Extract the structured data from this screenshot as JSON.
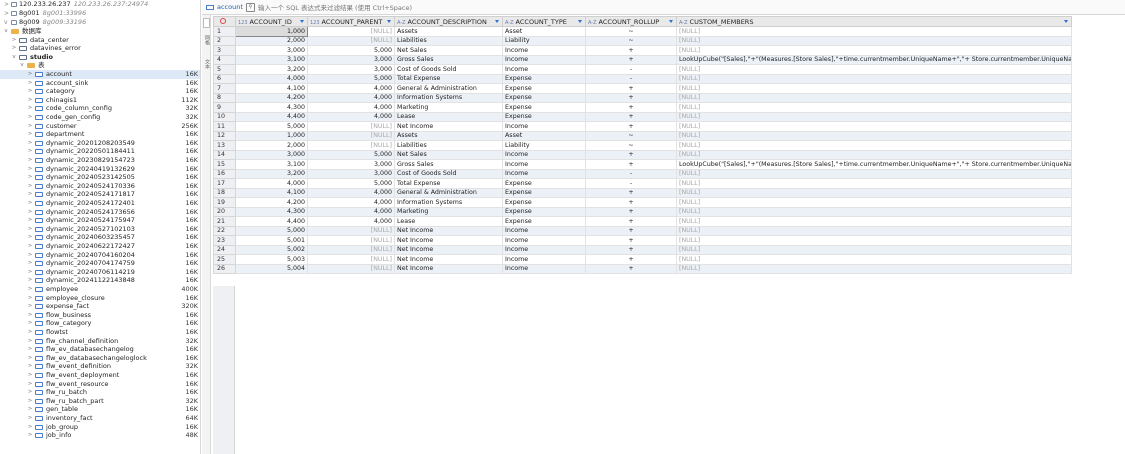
{
  "connections": [
    {
      "name": "120.233.26.237",
      "address": "120.233.26.237:24974",
      "toggle": ">"
    },
    {
      "name": "8g001",
      "address": "8g001:33996",
      "toggle": ">"
    },
    {
      "name": "8g009",
      "address": "8g009:33196",
      "toggle": "v"
    }
  ],
  "tree": [
    {
      "label": "数据库",
      "level": 1,
      "toggle": "v",
      "kind": "db",
      "size": ""
    },
    {
      "label": "data_center",
      "level": 2,
      "toggle": ">",
      "kind": "dt",
      "size": ""
    },
    {
      "label": "datavines_error",
      "level": 2,
      "toggle": ">",
      "kind": "dt",
      "size": ""
    },
    {
      "label": "studio",
      "level": 2,
      "toggle": "v",
      "kind": "dt",
      "size": "",
      "bold": true
    },
    {
      "label": "表",
      "level": 3,
      "toggle": "v",
      "kind": "db",
      "size": ""
    },
    {
      "label": "account",
      "level": 4,
      "toggle": ">",
      "kind": "tb",
      "size": "16K",
      "selected": true
    },
    {
      "label": "account_sink",
      "level": 4,
      "toggle": ">",
      "kind": "tb",
      "size": "16K"
    },
    {
      "label": "category",
      "level": 4,
      "toggle": ">",
      "kind": "tb",
      "size": "16K"
    },
    {
      "label": "chinagis1",
      "level": 4,
      "toggle": ">",
      "kind": "tb",
      "size": "112K"
    },
    {
      "label": "code_column_config",
      "level": 4,
      "toggle": ">",
      "kind": "tb",
      "size": "32K"
    },
    {
      "label": "code_gen_config",
      "level": 4,
      "toggle": ">",
      "kind": "tb",
      "size": "32K"
    },
    {
      "label": "customer",
      "level": 4,
      "toggle": ">",
      "kind": "tb",
      "size": "256K"
    },
    {
      "label": "department",
      "level": 4,
      "toggle": ">",
      "kind": "tb",
      "size": "16K"
    },
    {
      "label": "dynamic_20201208203549",
      "level": 4,
      "toggle": ">",
      "kind": "tb",
      "size": "16K"
    },
    {
      "label": "dynamic_20220501184411",
      "level": 4,
      "toggle": ">",
      "kind": "tb",
      "size": "16K"
    },
    {
      "label": "dynamic_20230829154723",
      "level": 4,
      "toggle": ">",
      "kind": "tb",
      "size": "16K"
    },
    {
      "label": "dynamic_20240419132629",
      "level": 4,
      "toggle": ">",
      "kind": "tb",
      "size": "16K"
    },
    {
      "label": "dynamic_20240523142505",
      "level": 4,
      "toggle": ">",
      "kind": "tb",
      "size": "16K"
    },
    {
      "label": "dynamic_20240524170336",
      "level": 4,
      "toggle": ">",
      "kind": "tb",
      "size": "16K"
    },
    {
      "label": "dynamic_20240524171817",
      "level": 4,
      "toggle": ">",
      "kind": "tb",
      "size": "16K"
    },
    {
      "label": "dynamic_20240524172401",
      "level": 4,
      "toggle": ">",
      "kind": "tb",
      "size": "16K"
    },
    {
      "label": "dynamic_20240524173656",
      "level": 4,
      "toggle": ">",
      "kind": "tb",
      "size": "16K"
    },
    {
      "label": "dynamic_20240524175947",
      "level": 4,
      "toggle": ">",
      "kind": "tb",
      "size": "16K"
    },
    {
      "label": "dynamic_20240527102103",
      "level": 4,
      "toggle": ">",
      "kind": "tb",
      "size": "16K"
    },
    {
      "label": "dynamic_20240603235457",
      "level": 4,
      "toggle": ">",
      "kind": "tb",
      "size": "16K"
    },
    {
      "label": "dynamic_20240622172427",
      "level": 4,
      "toggle": ">",
      "kind": "tb",
      "size": "16K"
    },
    {
      "label": "dynamic_20240704160204",
      "level": 4,
      "toggle": ">",
      "kind": "tb",
      "size": "16K"
    },
    {
      "label": "dynamic_20240704174759",
      "level": 4,
      "toggle": ">",
      "kind": "tb",
      "size": "16K"
    },
    {
      "label": "dynamic_20240706114219",
      "level": 4,
      "toggle": ">",
      "kind": "tb",
      "size": "16K"
    },
    {
      "label": "dynamic_20241122143848",
      "level": 4,
      "toggle": ">",
      "kind": "tb",
      "size": "16K"
    },
    {
      "label": "employee",
      "level": 4,
      "toggle": ">",
      "kind": "tb",
      "size": "400K"
    },
    {
      "label": "employee_closure",
      "level": 4,
      "toggle": ">",
      "kind": "tb",
      "size": "16K"
    },
    {
      "label": "expense_fact",
      "level": 4,
      "toggle": ">",
      "kind": "tb",
      "size": "320K"
    },
    {
      "label": "flow_business",
      "level": 4,
      "toggle": ">",
      "kind": "tb",
      "size": "16K"
    },
    {
      "label": "flow_category",
      "level": 4,
      "toggle": ">",
      "kind": "tb",
      "size": "16K"
    },
    {
      "label": "flowtst",
      "level": 4,
      "toggle": ">",
      "kind": "tb",
      "size": "16K"
    },
    {
      "label": "flw_channel_definition",
      "level": 4,
      "toggle": ">",
      "kind": "tb",
      "size": "32K"
    },
    {
      "label": "flw_ev_databasechangelog",
      "level": 4,
      "toggle": ">",
      "kind": "tb",
      "size": "16K"
    },
    {
      "label": "flw_ev_databasechangeloglock",
      "level": 4,
      "toggle": ">",
      "kind": "tb",
      "size": "16K"
    },
    {
      "label": "flw_event_definition",
      "level": 4,
      "toggle": ">",
      "kind": "tb",
      "size": "32K"
    },
    {
      "label": "flw_event_deployment",
      "level": 4,
      "toggle": ">",
      "kind": "tb",
      "size": "16K"
    },
    {
      "label": "flw_event_resource",
      "level": 4,
      "toggle": ">",
      "kind": "tb",
      "size": "16K"
    },
    {
      "label": "flw_ru_batch",
      "level": 4,
      "toggle": ">",
      "kind": "tb",
      "size": "16K"
    },
    {
      "label": "flw_ru_batch_part",
      "level": 4,
      "toggle": ">",
      "kind": "tb",
      "size": "32K"
    },
    {
      "label": "gen_table",
      "level": 4,
      "toggle": ">",
      "kind": "tb",
      "size": "16K"
    },
    {
      "label": "inventory_fact",
      "level": 4,
      "toggle": ">",
      "kind": "tb",
      "size": "64K"
    },
    {
      "label": "job_group",
      "level": 4,
      "toggle": ">",
      "kind": "tb",
      "size": "16K"
    },
    {
      "label": "job_info",
      "level": 4,
      "toggle": ">",
      "kind": "tb",
      "size": "48K"
    }
  ],
  "editor": {
    "tab_name": "account",
    "filter_icon": "filter-icon",
    "filter_placeholder": "输入一个 SQL 表达式来过滤结果 (使用 Ctrl+Space)",
    "side_labels": [
      "网格",
      "文本"
    ]
  },
  "columns": [
    {
      "name": "ACCOUNT_ID",
      "type_tag": "123"
    },
    {
      "name": "ACCOUNT_PARENT",
      "type_tag": "123"
    },
    {
      "name": "ACCOUNT_DESCRIPTION",
      "type_tag": "A-Z"
    },
    {
      "name": "ACCOUNT_TYPE",
      "type_tag": "A-Z"
    },
    {
      "name": "ACCOUNT_ROLLUP",
      "type_tag": "A-Z"
    },
    {
      "name": "CUSTOM_MEMBERS",
      "type_tag": "A-Z"
    }
  ],
  "rows": [
    [
      "1",
      "1,000",
      "[NULL]",
      "Assets",
      "Asset",
      "~",
      "[NULL]"
    ],
    [
      "2",
      "2,000",
      "[NULL]",
      "Liabilities",
      "Liability",
      "~",
      "[NULL]"
    ],
    [
      "3",
      "3,000",
      "5,000",
      "Net Sales",
      "Income",
      "+",
      "[NULL]"
    ],
    [
      "4",
      "3,100",
      "3,000",
      "Gross Sales",
      "Income",
      "+",
      "LookUpCube(\"[Sales],\"+\"(Measures.[Store Sales],\"+time.currentmember.UniqueName+\",\"+ Store.currentmember.UniqueName+\")\")"
    ],
    [
      "5",
      "3,200",
      "3,000",
      "Cost of Goods Sold",
      "Income",
      "-",
      "[NULL]"
    ],
    [
      "6",
      "4,000",
      "5,000",
      "Total Expense",
      "Expense",
      "-",
      "[NULL]"
    ],
    [
      "7",
      "4,100",
      "4,000",
      "General & Administration",
      "Expense",
      "+",
      "[NULL]"
    ],
    [
      "8",
      "4,200",
      "4,000",
      "Information Systems",
      "Expense",
      "+",
      "[NULL]"
    ],
    [
      "9",
      "4,300",
      "4,000",
      "Marketing",
      "Expense",
      "+",
      "[NULL]"
    ],
    [
      "10",
      "4,400",
      "4,000",
      "Lease",
      "Expense",
      "+",
      "[NULL]"
    ],
    [
      "11",
      "5,000",
      "[NULL]",
      "Net Income",
      "Income",
      "+",
      "[NULL]"
    ],
    [
      "12",
      "1,000",
      "[NULL]",
      "Assets",
      "Asset",
      "~",
      "[NULL]"
    ],
    [
      "13",
      "2,000",
      "[NULL]",
      "Liabilities",
      "Liability",
      "~",
      "[NULL]"
    ],
    [
      "14",
      "3,000",
      "5,000",
      "Net Sales",
      "Income",
      "+",
      "[NULL]"
    ],
    [
      "15",
      "3,100",
      "3,000",
      "Gross Sales",
      "Income",
      "+",
      "LookUpCube(\"[Sales],\"+\"(Measures.[Store Sales],\"+time.currentmember.UniqueName+\",\"+ Store.currentmember.UniqueName+\")\")"
    ],
    [
      "16",
      "3,200",
      "3,000",
      "Cost of Goods Sold",
      "Income",
      "-",
      "[NULL]"
    ],
    [
      "17",
      "4,000",
      "5,000",
      "Total Expense",
      "Expense",
      "-",
      "[NULL]"
    ],
    [
      "18",
      "4,100",
      "4,000",
      "General & Administration",
      "Expense",
      "+",
      "[NULL]"
    ],
    [
      "19",
      "4,200",
      "4,000",
      "Information Systems",
      "Expense",
      "+",
      "[NULL]"
    ],
    [
      "20",
      "4,300",
      "4,000",
      "Marketing",
      "Expense",
      "+",
      "[NULL]"
    ],
    [
      "21",
      "4,400",
      "4,000",
      "Lease",
      "Expense",
      "+",
      "[NULL]"
    ],
    [
      "22",
      "5,000",
      "[NULL]",
      "Net Income",
      "Income",
      "+",
      "[NULL]"
    ],
    [
      "23",
      "5,001",
      "[NULL]",
      "Net Income",
      "Income",
      "+",
      "[NULL]"
    ],
    [
      "24",
      "5,002",
      "[NULL]",
      "Net Income",
      "Income",
      "+",
      "[NULL]"
    ],
    [
      "25",
      "5,003",
      "[NULL]",
      "Net Income",
      "Income",
      "+",
      "[NULL]"
    ],
    [
      "26",
      "5,004",
      "[NULL]",
      "Net Income",
      "Income",
      "+",
      "[NULL]"
    ]
  ],
  "colors": {
    "accent": "#2b6fd0",
    "selection": "#dde9f7",
    "null_text": "#a8a8a8",
    "alt_row": "#ecf1f8"
  }
}
